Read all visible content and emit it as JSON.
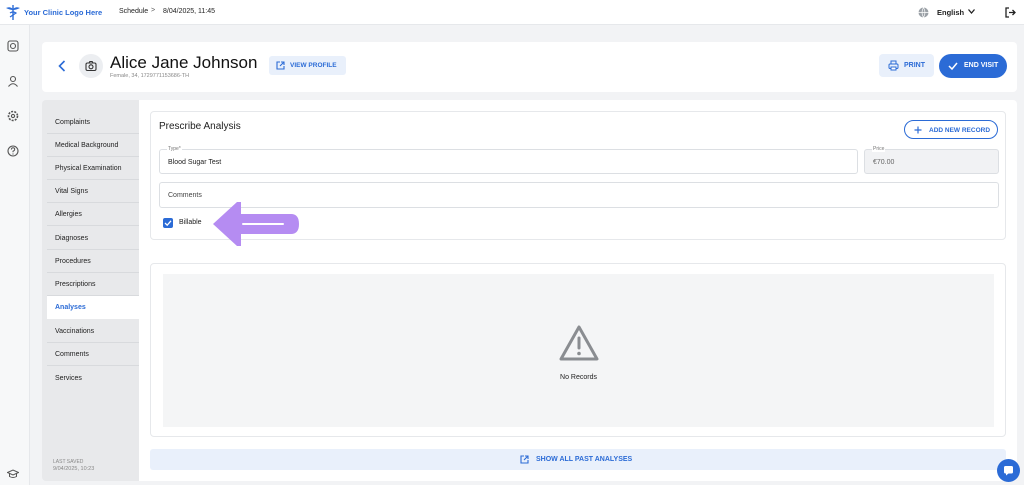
{
  "topbar": {
    "logo_text": "Your Clinic Logo Here",
    "breadcrumb": {
      "schedule": "Schedule",
      "separator": ">",
      "date": "8/04/2025, 11:45"
    },
    "language": "English"
  },
  "rail": {
    "icons": [
      "dashboard-icon",
      "user-icon",
      "settings-icon",
      "help-icon",
      "graduation-cap-icon"
    ]
  },
  "patient": {
    "name": "Alice Jane Johnson",
    "info": "Female, 34, 1729771153686-TH",
    "view_profile": "VIEW PROFILE"
  },
  "actions": {
    "print": "PRINT",
    "end_visit": "END VISIT"
  },
  "sections": {
    "items": [
      "Complaints",
      "Medical Background",
      "Physical Examination",
      "Vital Signs",
      "Allergies",
      "Diagnoses",
      "Procedures",
      "Prescriptions",
      "Analyses",
      "Vaccinations",
      "Comments",
      "Services"
    ],
    "active": "Analyses",
    "last_saved_label": "LAST SAVED",
    "last_saved_value": "9/04/2025, 10:23"
  },
  "prescribe": {
    "title": "Prescribe Analysis",
    "add_record": "ADD NEW RECORD",
    "type_label": "Type*",
    "type_value": "Blood Sugar Test",
    "price_label": "Price",
    "price_value": "€70.00",
    "comments_placeholder": "Comments",
    "billable_label": "Billable",
    "billable_checked": true
  },
  "records": {
    "empty_text": "No Records",
    "show_all": "SHOW ALL PAST ANALYSES"
  },
  "colors": {
    "accent": "#2b6bd6",
    "annotation_arrow": "#b58cf2"
  }
}
